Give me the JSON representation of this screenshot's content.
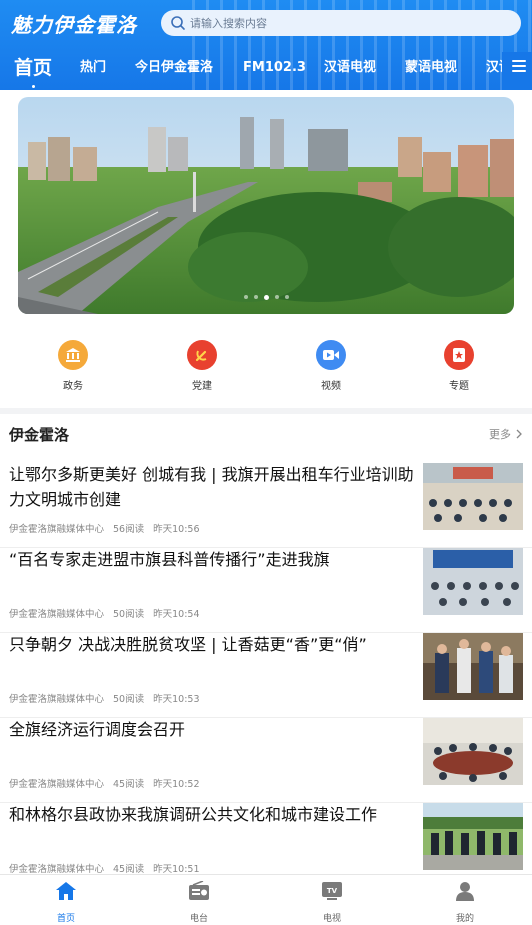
{
  "header": {
    "logo_text": "魅力伊金霍洛",
    "search_placeholder": "请输入搜索内容"
  },
  "tabs": [
    {
      "label": "首页",
      "active": true
    },
    {
      "label": "热门"
    },
    {
      "label": "今日伊金霍洛"
    },
    {
      "label": "FM102.3"
    },
    {
      "label": "汉语电视"
    },
    {
      "label": "蒙语电视"
    },
    {
      "label": "汉语"
    }
  ],
  "banner": {
    "page_count": 5,
    "active_index": 2
  },
  "quick_links": [
    {
      "label": "政务",
      "icon": "government-icon",
      "color": "#f5a93a"
    },
    {
      "label": "党建",
      "icon": "party-icon",
      "color": "#e8412f"
    },
    {
      "label": "视频",
      "icon": "video-icon",
      "color": "#3f8bf2"
    },
    {
      "label": "专题",
      "icon": "topic-icon",
      "color": "#e8412f"
    }
  ],
  "section": {
    "title": "伊金霍洛",
    "more": "更多"
  },
  "news": [
    {
      "title": "让鄂尔多斯更美好 创城有我 | 我旗开展出租车行业培训助力文明城市创建",
      "source": "伊金霍洛旗融媒体中心",
      "reads": "56阅读",
      "time": "昨天10:56"
    },
    {
      "title": "“百名专家走进盟市旗县科普传播行”走进我旗",
      "source": "伊金霍洛旗融媒体中心",
      "reads": "50阅读",
      "time": "昨天10:54"
    },
    {
      "title": "只争朝夕 决战决胜脱贫攻坚 | 让香菇更“香”更“俏”",
      "source": "伊金霍洛旗融媒体中心",
      "reads": "50阅读",
      "time": "昨天10:53"
    },
    {
      "title": "全旗经济运行调度会召开",
      "source": "伊金霍洛旗融媒体中心",
      "reads": "45阅读",
      "time": "昨天10:52"
    },
    {
      "title": "和林格尔县政协来我旗调研公共文化和城市建设工作",
      "source": "伊金霍洛旗融媒体中心",
      "reads": "45阅读",
      "time": "昨天10:51"
    }
  ],
  "bottom_nav": [
    {
      "label": "首页",
      "icon": "home-icon",
      "active": true
    },
    {
      "label": "电台",
      "icon": "radio-icon"
    },
    {
      "label": "电视",
      "icon": "tv-icon"
    },
    {
      "label": "我的",
      "icon": "profile-icon"
    }
  ],
  "colors": {
    "primary": "#1677e8",
    "accent_red": "#e8412f",
    "accent_orange": "#f5a93a"
  }
}
